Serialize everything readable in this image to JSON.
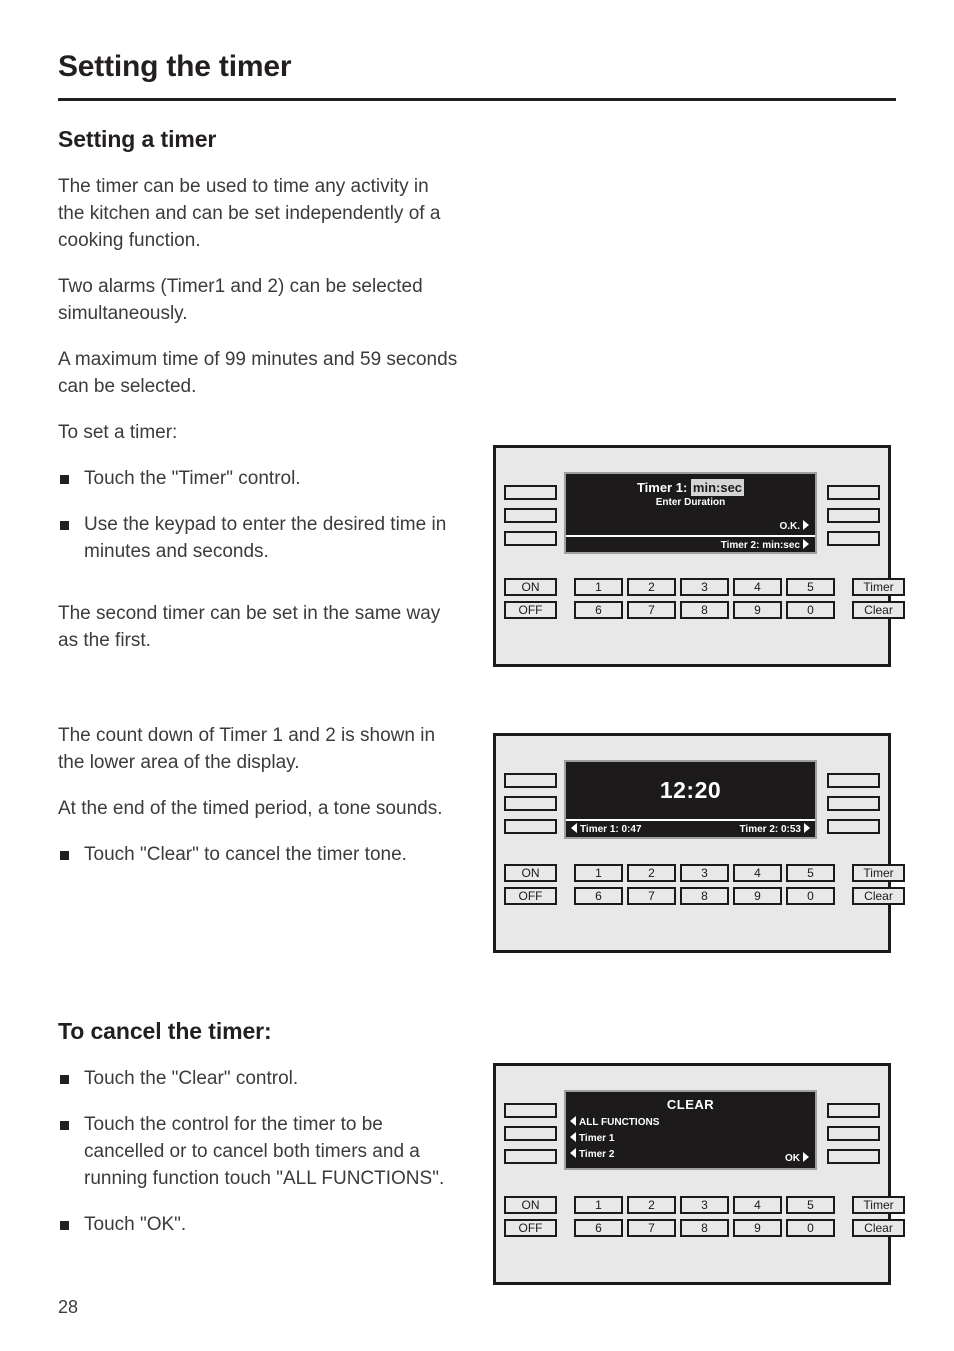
{
  "document": {
    "title": "Setting the timer",
    "page_number": "28"
  },
  "sections": [
    {
      "heading": "Setting a timer",
      "paragraphs": [
        "The timer can be used to time any activity in the kitchen and can be set independently of a cooking function.",
        "Two alarms (Timer1 and 2) can be selected simultaneously.",
        "A maximum time of 99 minutes and 59 seconds can be selected.",
        "To set a timer:"
      ],
      "bullets": [
        "Touch the \"Timer\" control.",
        "Use the keypad to enter the desired time in minutes and seconds."
      ],
      "closing": "The second timer can be set in the same way as the first."
    },
    {
      "paragraphs": [
        "The count down of Timer 1 and 2 is shown in the lower area of the display.",
        "At the end of the timed period, a tone sounds."
      ],
      "bullets": [
        "Touch \"Clear\" to cancel the timer tone."
      ]
    },
    {
      "heading": "To cancel the timer:",
      "bullets": [
        "Touch the \"Clear\" control.",
        "Touch the control for the timer to be cancelled or to cancel both timers and a running function touch \"ALL FUNCTIONS\".",
        "Touch \"OK\"."
      ]
    }
  ],
  "control_panel": {
    "keypad": {
      "on_label": "ON",
      "off_label": "OFF",
      "numbers_top": [
        "1",
        "2",
        "3",
        "4",
        "5"
      ],
      "numbers_bottom": [
        "6",
        "7",
        "8",
        "9",
        "0"
      ],
      "timer_label": "Timer",
      "clear_label": "Clear"
    },
    "figure_1": {
      "title_prefix": "Timer 1:",
      "title_highlight": "min:sec",
      "subtitle": "Enter Duration",
      "ok_label": "O.K.",
      "bottom_bar": "Timer 2: min:sec"
    },
    "figure_2": {
      "clock": "12:20",
      "timer_1": "Timer 1: 0:47",
      "timer_2": "Timer 2: 0:53"
    },
    "figure_3": {
      "title": "CLEAR",
      "rows": [
        "ALL FUNCTIONS",
        "Timer 1",
        "Timer 2"
      ],
      "ok_label": "OK"
    }
  },
  "colors": {
    "panel_background": "#e8e8e8",
    "panel_border": "#1a1a1a",
    "screen_background": "#1c1a1a",
    "screen_text": "#ffffff",
    "highlight": "#d4d4d4",
    "text": "#3b3b3b"
  }
}
